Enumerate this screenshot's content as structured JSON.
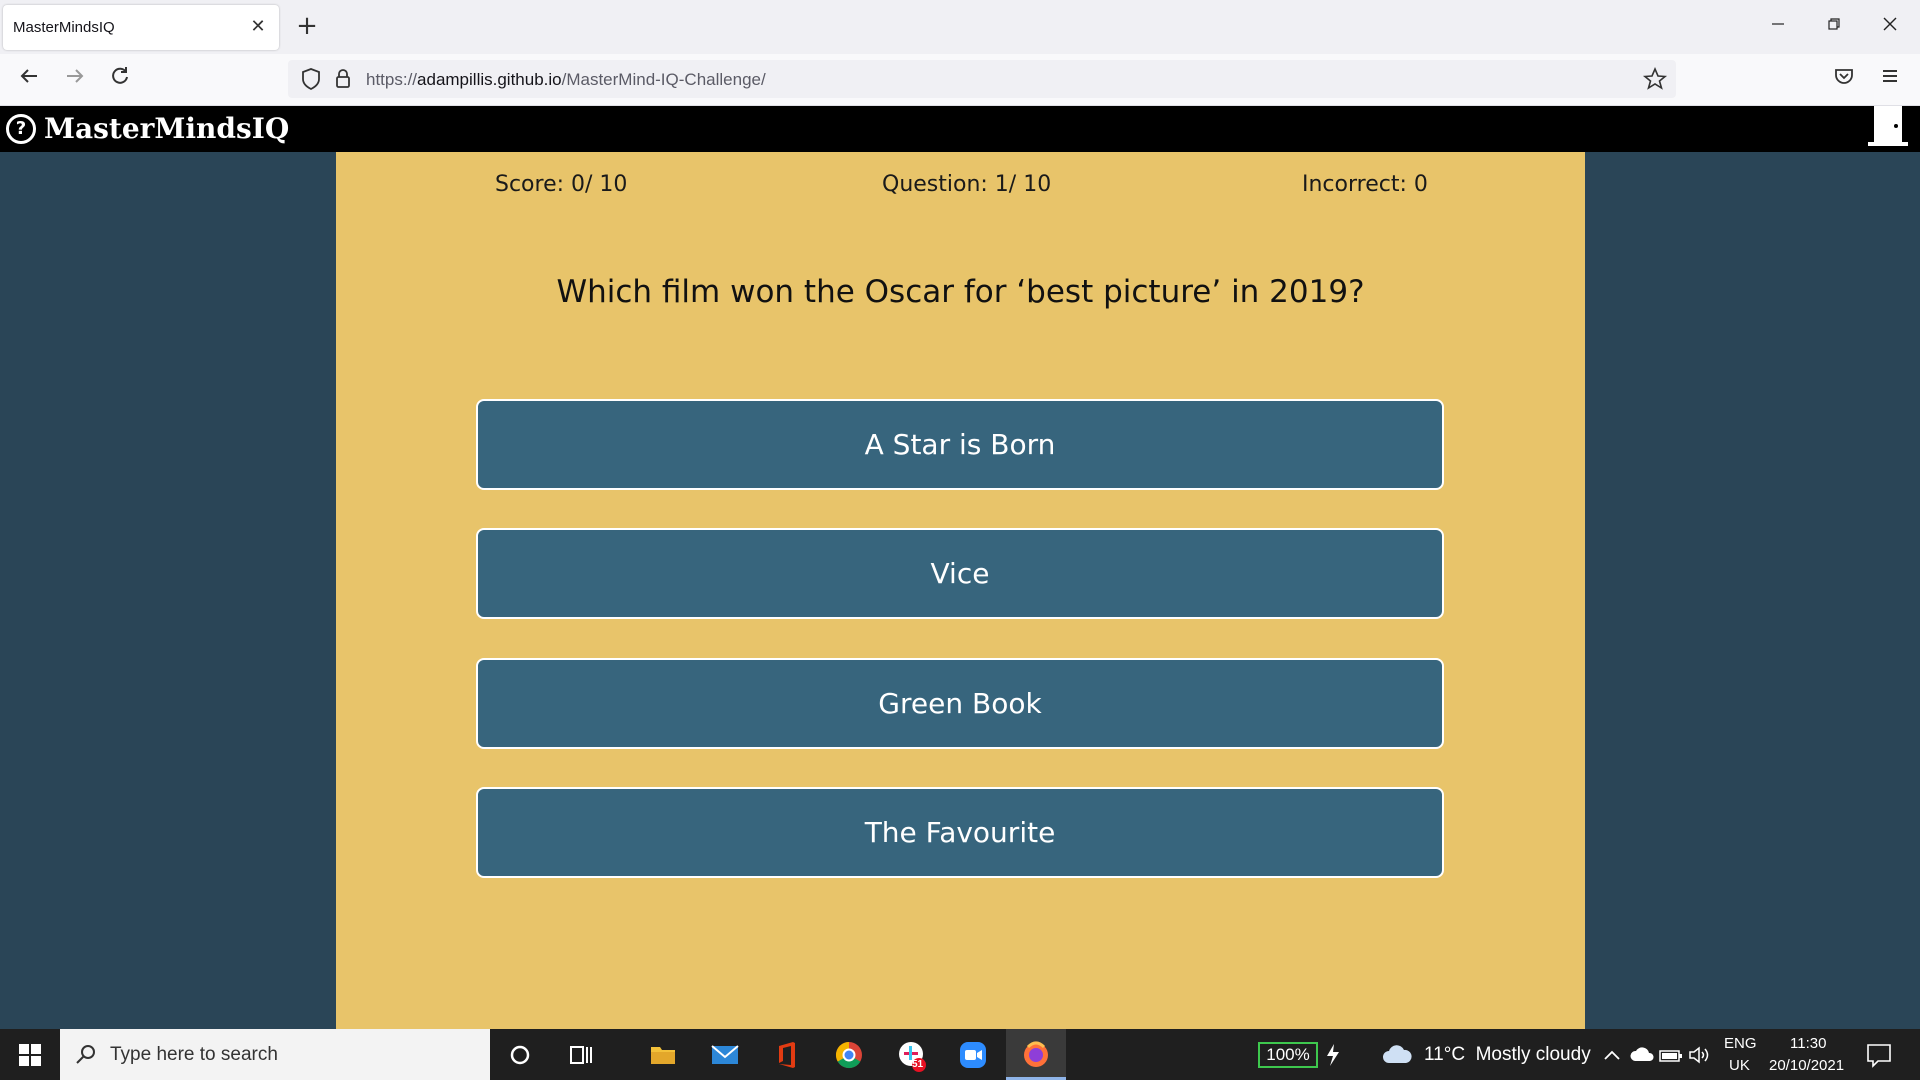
{
  "browser": {
    "tab_title": "MasterMindsIQ",
    "tab_close": "✕",
    "new_tab": "+",
    "url_scheme": "https://",
    "url_host": "adampillis.github.io",
    "url_path": "/MasterMind-IQ-Challenge/"
  },
  "app": {
    "brand_name": "MasterMindsIQ",
    "brand_icon": "question-circle-icon",
    "exit_icon": "door-icon"
  },
  "quiz": {
    "score": "Score: 0/ 10",
    "question_counter": "Question: 1/ 10",
    "incorrect": "Incorrect: 0",
    "question": "Which film won the Oscar for ‘best picture’ in 2019?",
    "answers": [
      "A Star is Born",
      "Vice",
      "Green Book",
      "The Favourite"
    ]
  },
  "taskbar": {
    "search_placeholder": "Type here to search",
    "battery": "100%",
    "weather": "11°C  Mostly cloudy",
    "lang_1": "ENG",
    "lang_2": "UK",
    "time": "11:30",
    "date": "20/10/2021",
    "notification_badge": "51"
  },
  "colors": {
    "page_bg": "#2a4557",
    "panel_bg": "#e8c46a",
    "answer_bg": "#37657d",
    "header_bg": "#000000"
  }
}
